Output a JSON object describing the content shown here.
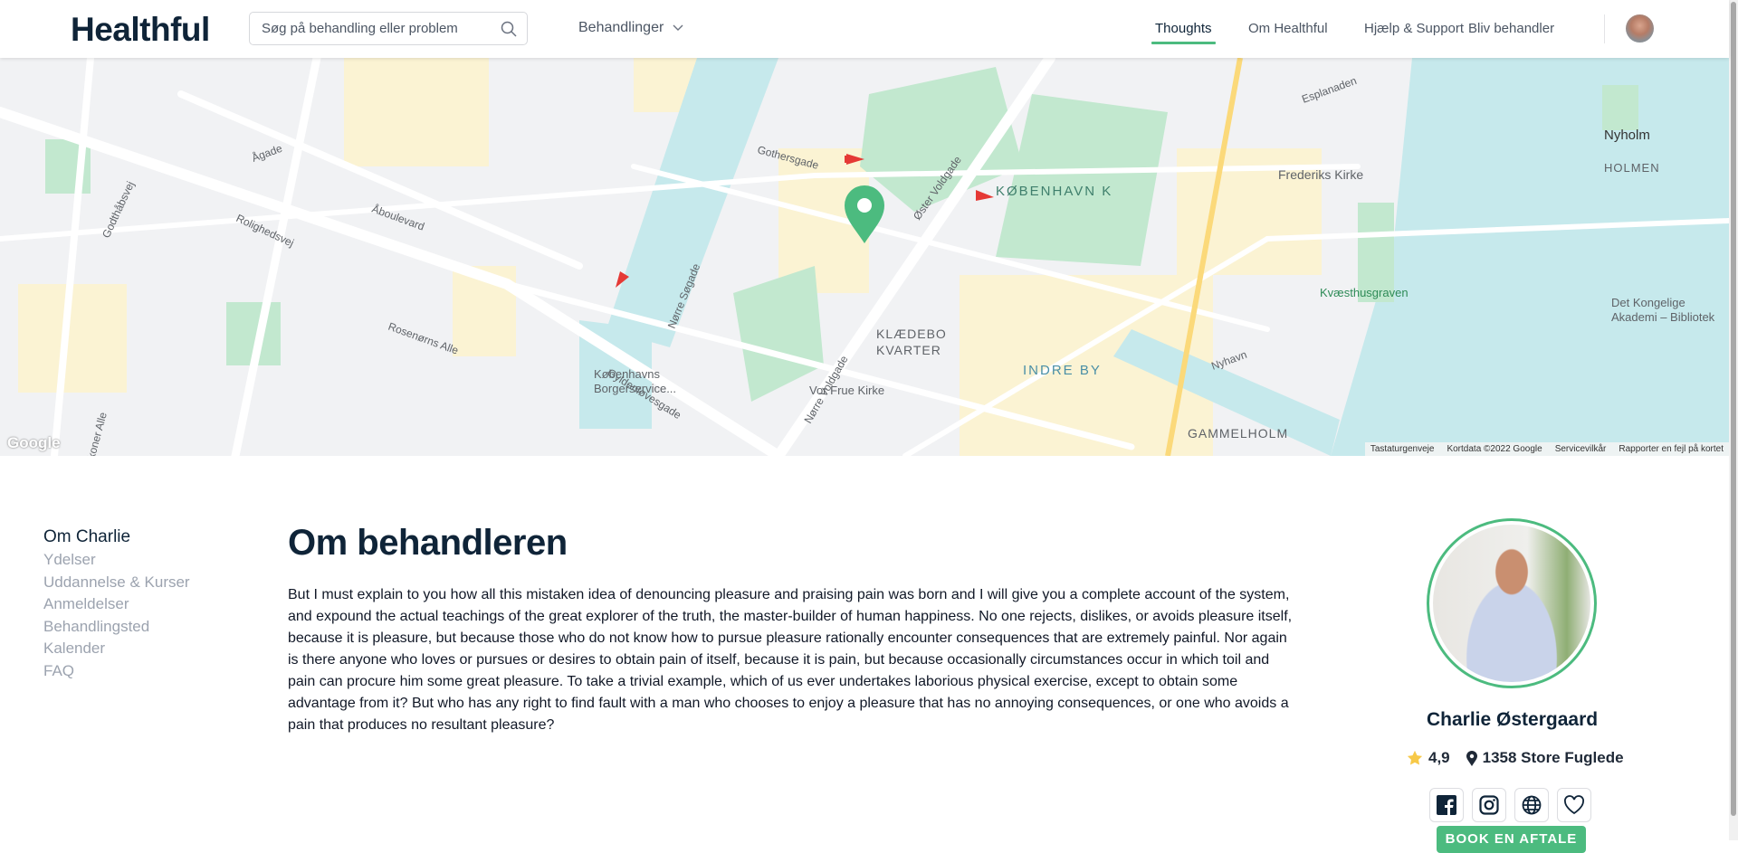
{
  "header": {
    "logo": "Healthful",
    "search_placeholder": "Søg på behandling eller problem",
    "menu_label": "Behandlinger",
    "nav": [
      {
        "label": "Thoughts",
        "active": true
      },
      {
        "label": "Om Healthful"
      },
      {
        "label": "Hjælp & Support"
      },
      {
        "label": "Bliv behandler"
      }
    ]
  },
  "map": {
    "labels": [
      "Ågade",
      "Åboulevard",
      "Rosenørns Alle",
      "Nørre Søgade",
      "Gyldenløvesgade",
      "Øster Voldgade",
      "Nørre Voldgade",
      "KØBENHAVN K",
      "KLÆDEBO",
      "KVARTER",
      "INDRE BY",
      "GAMMELHOLM",
      "Frederiks Kirke",
      "Nyholm",
      "HOLMEN",
      "Kvæsthusgraven",
      "Det Kongelige",
      "Akademi – Bibliotek",
      "Vor Frue Kirke",
      "Københavns",
      "Borgerservice...",
      "Rolighedsvej",
      "Falkoner Alle",
      "Godthåbsvej",
      "Gothersgade",
      "Nyhavn",
      "Esplanaden"
    ],
    "google": "Google",
    "attribution": [
      "Tastaturgenveje",
      "Kortdata ©2022 Google",
      "Servicevilkår",
      "Rapporter en fejl på kortet"
    ],
    "colors": {
      "water": "#c6e9ec",
      "park": "#c2e8cf",
      "urban": "#fbf3d3",
      "marker": "#4cbb7f"
    }
  },
  "sidenav": [
    "Om Charlie",
    "Ydelser",
    "Uddannelse & Kurser",
    "Anmeldelser",
    "Behandlingsted",
    "Kalender",
    "FAQ"
  ],
  "about": {
    "title": "Om behandleren",
    "text": "But I must explain to you how all this mistaken idea of denouncing pleasure and praising pain was born and I will give you a complete account of the system, and expound the actual teachings of the great explorer of the truth, the master-builder of human happiness. No one rejects, dislikes, or avoids pleasure itself, because it is pleasure, but because those who do not know how to pursue pleasure rationally encounter consequences that are extremely painful. Nor again is there anyone who loves or pursues or desires to obtain pain of itself, because it is pain, but because occasionally circumstances occur in which toil and pain can procure him some great pleasure. To take a trivial example, which of us ever undertakes laborious physical exercise, except to obtain some advantage from it? But who has any right to find fault with a man who chooses to enjoy a pleasure that has no annoying consequences, or one who avoids a pain that produces no resultant pleasure?"
  },
  "profile": {
    "name": "Charlie Østergaard",
    "rating": "4,9",
    "location": "1358 Store Fuglede",
    "book_label": "BOOK EN AFTALE",
    "socials": [
      "facebook-icon",
      "instagram-icon",
      "globe-icon",
      "heart-icon"
    ]
  },
  "colors": {
    "accent": "#4cbb7f",
    "dark": "#0f2438",
    "star": "#f7c948"
  }
}
